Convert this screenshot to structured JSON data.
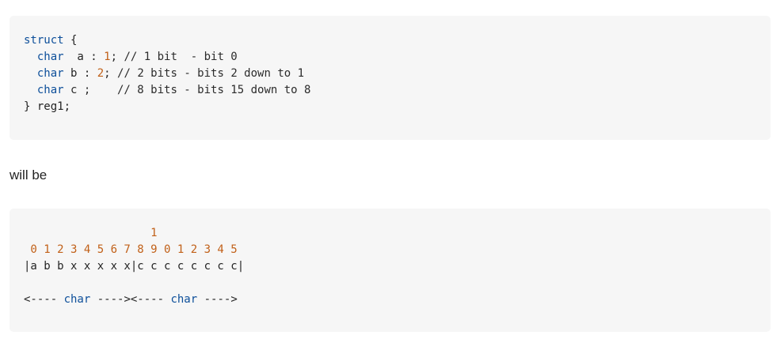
{
  "code_block_1": {
    "line1": {
      "kw": "struct",
      "rest": " {"
    },
    "line2": {
      "indent": "  ",
      "kw": "char",
      "mid": "  a : ",
      "num": "1",
      "rest": "; // 1 bit  - bit 0"
    },
    "line3": {
      "indent": "  ",
      "kw": "char",
      "mid": " b : ",
      "num": "2",
      "rest": "; // 2 bits - bits 2 down to 1"
    },
    "line4": {
      "indent": "  ",
      "kw": "char",
      "rest": " c ;    // 8 bits - bits 15 down to 8"
    },
    "line5": {
      "text": "} reg1;"
    }
  },
  "prose": "will be",
  "code_block_2": {
    "line1": "                   1",
    "line2": " 0 1 2 3 4 5 6 7 8 9 0 1 2 3 4 5",
    "line3": "|a b b x x x x x|c c c c c c c c|",
    "line4": "",
    "line5": {
      "arrow_a": "<---- ",
      "kw_a": "char",
      "arrow_b": " ----><---- ",
      "kw_b": "char",
      "arrow_c": " ---->"
    }
  }
}
